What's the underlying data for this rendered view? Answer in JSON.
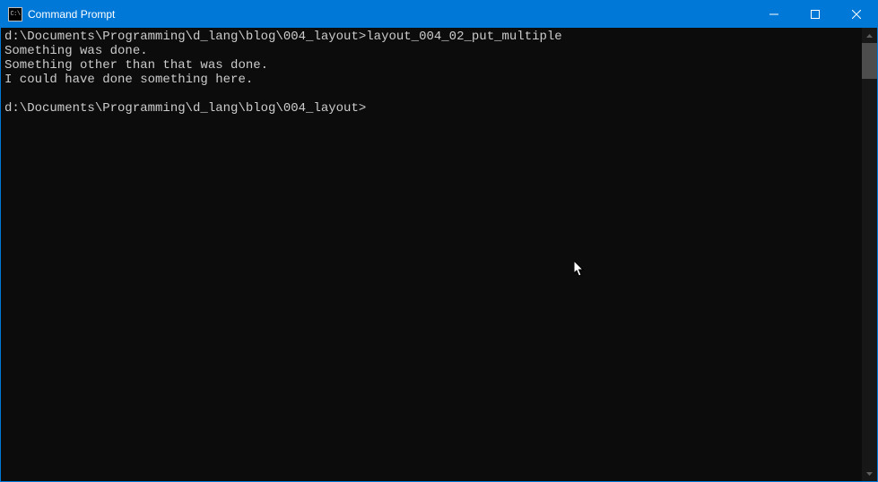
{
  "window": {
    "title": "Command Prompt",
    "icon_text": "C:\\"
  },
  "terminal": {
    "lines": [
      {
        "prompt": "d:\\Documents\\Programming\\d_lang\\blog\\004_layout>",
        "command": "layout_004_02_put_multiple"
      },
      {
        "prompt": "",
        "command": "Something was done."
      },
      {
        "prompt": "",
        "command": "Something other than that was done."
      },
      {
        "prompt": "",
        "command": "I could have done something here."
      },
      {
        "prompt": "",
        "command": ""
      },
      {
        "prompt": "d:\\Documents\\Programming\\d_lang\\blog\\004_layout>",
        "command": ""
      }
    ]
  }
}
